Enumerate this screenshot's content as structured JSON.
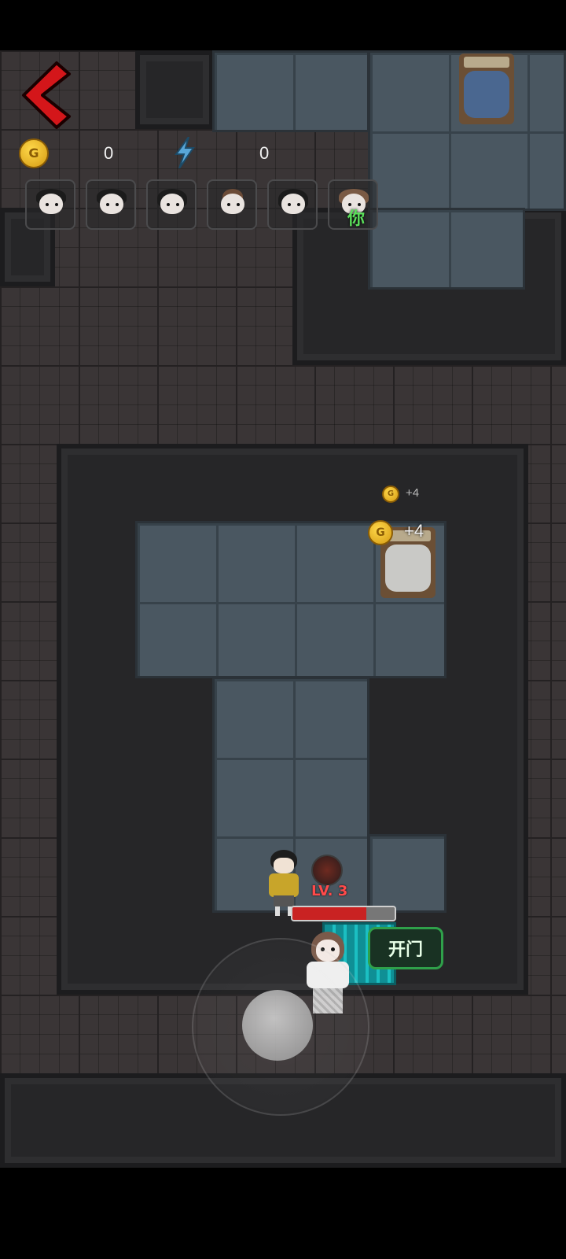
{
  "hud": {
    "back_icon": "back-chevron-icon",
    "gold_icon_letter": "G",
    "gold_value": "0",
    "energy_icon": "lightning-icon",
    "energy_value": "0"
  },
  "players": [
    {
      "name": "player-1"
    },
    {
      "name": "player-2"
    },
    {
      "name": "player-3"
    },
    {
      "name": "player-4"
    },
    {
      "name": "player-5"
    },
    {
      "name": "player-self",
      "tag": "你"
    }
  ],
  "floating": {
    "gold_small": "+4",
    "gold_big": "+4",
    "coin_letter": "G"
  },
  "enemy": {
    "level_label": "LV. 3",
    "hp_fraction": 0.72
  },
  "action": {
    "open_door_label": "开门"
  },
  "colors": {
    "accent_red": "#d4161a",
    "button_green": "#2fa04a",
    "you_tag_green": "#5be05b",
    "level_red": "#ff4a4a",
    "floor_tile": "#3a3536",
    "room_floor": "#4a5761"
  }
}
